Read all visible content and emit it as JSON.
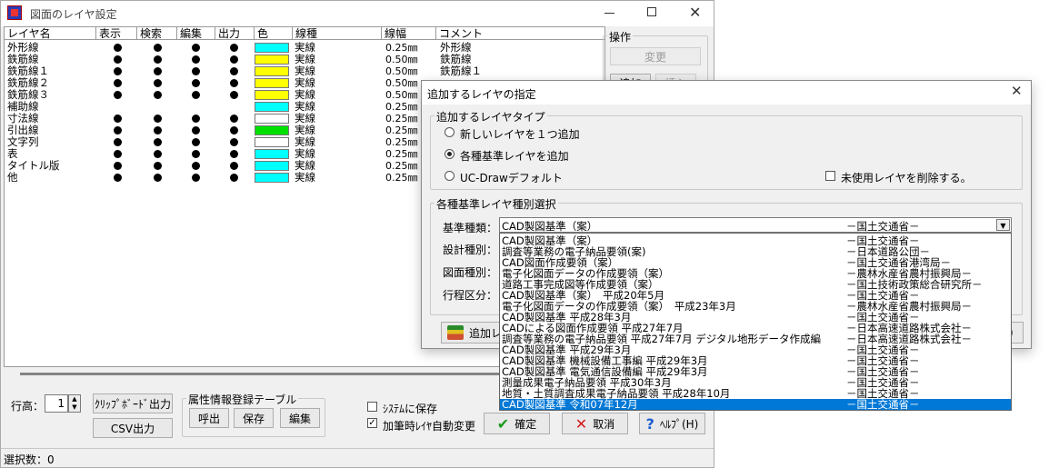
{
  "main": {
    "title": "図面のレイヤ設定",
    "columns": [
      "レイヤ名",
      "表示",
      "検索",
      "編集",
      "出力",
      "色",
      "線種",
      "線幅",
      "コメント"
    ],
    "rows": [
      {
        "name": "外形線",
        "show": true,
        "search": true,
        "edit": true,
        "output": true,
        "color": "#00ffff",
        "linetype": "実線",
        "width": "0.25㎜",
        "comment": "外形線"
      },
      {
        "name": "鉄筋線",
        "show": true,
        "search": true,
        "edit": true,
        "output": true,
        "color": "#ffff00",
        "linetype": "実線",
        "width": "0.50㎜",
        "comment": "鉄筋線"
      },
      {
        "name": "鉄筋線１",
        "show": true,
        "search": true,
        "edit": true,
        "output": true,
        "color": "#ffff00",
        "linetype": "実線",
        "width": "0.50㎜",
        "comment": "鉄筋線１"
      },
      {
        "name": "鉄筋線２",
        "show": true,
        "search": true,
        "edit": true,
        "output": true,
        "color": "#ffff00",
        "linetype": "実線",
        "width": "0.50㎜",
        "comment": ""
      },
      {
        "name": "鉄筋線３",
        "show": true,
        "search": true,
        "edit": true,
        "output": true,
        "color": "#ffff00",
        "linetype": "実線",
        "width": "0.50㎜",
        "comment": ""
      },
      {
        "name": "補助線",
        "show": false,
        "search": false,
        "edit": false,
        "output": false,
        "color": "#00ffff",
        "linetype": "実線",
        "width": "0.25㎜",
        "comment": ""
      },
      {
        "name": "寸法線",
        "show": true,
        "search": true,
        "edit": true,
        "output": true,
        "color": "#ffffff",
        "linetype": "実線",
        "width": "0.25㎜",
        "comment": ""
      },
      {
        "name": "引出線",
        "show": true,
        "search": true,
        "edit": true,
        "output": true,
        "color": "#00e000",
        "linetype": "実線",
        "width": "0.25㎜",
        "comment": ""
      },
      {
        "name": "文字列",
        "show": true,
        "search": true,
        "edit": true,
        "output": true,
        "color": "#ffffff",
        "linetype": "実線",
        "width": "0.25㎜",
        "comment": ""
      },
      {
        "name": "表",
        "show": true,
        "search": true,
        "edit": true,
        "output": true,
        "color": "#00ffff",
        "linetype": "実線",
        "width": "0.25㎜",
        "comment": ""
      },
      {
        "name": "タイトル版",
        "show": true,
        "search": true,
        "edit": true,
        "output": true,
        "color": "#00ffff",
        "linetype": "実線",
        "width": "0.25㎜",
        "comment": ""
      },
      {
        "name": "他",
        "show": true,
        "search": true,
        "edit": true,
        "output": true,
        "color": "#00ffff",
        "linetype": "実線",
        "width": "0.25㎜",
        "comment": ""
      }
    ],
    "ops_group": "操作",
    "change_btn": "変更",
    "add_btn": "追加",
    "insert_btn": "挿入",
    "row_height_label": "行高：",
    "row_height_value": "1",
    "clipboard_btn": "ｸﾘｯﾌﾟﾎﾞｰﾄﾞ出力",
    "csv_btn": "CSV出力",
    "attr_group": "属性情報登録テーブル",
    "call_btn": "呼出",
    "save_btn": "保存",
    "edit_btn": "編集",
    "system_save": "ｼｽﾃﾑに保存",
    "auto_change": "加筆時ﾚｲﾔ自動変更",
    "ok_btn": "確定",
    "cancel_btn": "取消",
    "help_btn": "ﾍﾙﾌﾟ(H)",
    "status": "選択数：0"
  },
  "dialog": {
    "title": "追加するレイヤの指定",
    "type_group": "追加するレイヤタイプ",
    "radio_new": "新しいレイヤを１つ追加",
    "radio_std": "各種基準レイヤを追加",
    "radio_ucd": "UC-Drawデフォルト",
    "delete_unused": "未使用レイヤを削除する。",
    "kind_group": "各種基準レイヤ種別選択",
    "std_label": "基準種類：",
    "design_label": "設計種別：",
    "drawing_label": "図面種別：",
    "process_label": "行程区分：",
    "selected_name": "CAD製図基準（案）",
    "selected_org": "－国土交通省－",
    "add_btn_partial": "追加レ",
    "options": [
      {
        "name": "CAD製図基準（案）",
        "org": "－国土交通省－"
      },
      {
        "name": "調査等業務の電子納品要領(案)",
        "org": "－日本道路公団－"
      },
      {
        "name": "CAD図面作成要領（案）",
        "org": "－国土交通省港湾局－"
      },
      {
        "name": "電子化図面データの作成要領（案）",
        "org": "－農林水産省農村振興局－"
      },
      {
        "name": "道路工事完成図等作成要領（案）",
        "org": "－国土技術政策総合研究所－"
      },
      {
        "name": "CAD製図基準（案）　平成20年5月",
        "org": "－国土交通省－"
      },
      {
        "name": "電子化図面データの作成要領（案）　平成23年3月",
        "org": "－農林水産省農村振興局－"
      },
      {
        "name": "CAD製図基準 平成28年3月",
        "org": "－国土交通省－"
      },
      {
        "name": "CADによる図面作成要領 平成27年7月",
        "org": "－日本高速道路株式会社－"
      },
      {
        "name": "調査等業務の電子納品要領 平成27年7月 デジタル地形データ作成編",
        "org": "－日本高速道路株式会社－"
      },
      {
        "name": "CAD製図基準 平成29年3月",
        "org": "－国土交通省－"
      },
      {
        "name": "CAD製図基準 機械設備工事編 平成29年3月",
        "org": "－国土交通省－"
      },
      {
        "name": "CAD製図基準 電気通信設備編 平成29年3月",
        "org": "－国土交通省－"
      },
      {
        "name": "測量成果電子納品要領 平成30年3月",
        "org": "－国土交通省－"
      },
      {
        "name": "地質・土質調査成果電子納品要領 平成28年10月",
        "org": "－国土交通省－"
      },
      {
        "name": "CAD製図基準 令和07年12月",
        "org": "－国土交通省－"
      }
    ],
    "selected_option_index": 15
  }
}
